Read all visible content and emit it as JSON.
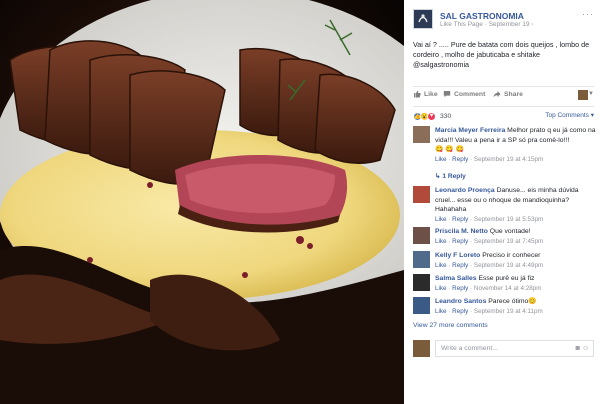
{
  "post": {
    "page_name": "SAL GASTRONOMIA",
    "like_page": "Like This Page",
    "date": "September 19",
    "text": "Vai aí ? ..... Pure de batata com dois queijos , lombo de cordeiro , molho de jabuticaba e shitake @salgastronomia"
  },
  "actions": {
    "like": "Like",
    "comment": "Comment",
    "share": "Share"
  },
  "reactions": {
    "count": "330",
    "top_comments": "Top Comments"
  },
  "comments": [
    {
      "name": "Marcia Meyer Ferreira",
      "text": "Melhor prato q eu já como na vida!!! Valeu a pena ir a SP só pra comê-lo!!!",
      "extra": "😋 😋 😋",
      "like": "Like",
      "reply": "Reply",
      "time": "September 19 at 4:15pm",
      "avatar": "#8a6e5a"
    },
    {
      "name": "Leonardo Proença",
      "text": "Danuse... eis minha dúvida cruel... esse ou o nhoque de mandioquinha? Hahahaha",
      "like": "Like",
      "reply": "Reply",
      "time": "September 19 at 5:53pm",
      "avatar": "#b24a3c"
    },
    {
      "name": "Priscila M. Netto",
      "text": "Que vontade!",
      "like": "Like",
      "reply": "Reply",
      "time": "September 19 at 7:45pm",
      "avatar": "#6d5149"
    },
    {
      "name": "Kelly F Loreto",
      "text": "Preciso ir conhecer",
      "like": "Like",
      "reply": "Reply",
      "time": "September 19 at 4:49pm",
      "avatar": "#4f6a8a"
    },
    {
      "name": "Salma Salles",
      "text": "Esse purê eu já fiz",
      "like": "Like",
      "reply": "Reply",
      "time": "November 14 at 4:28pm",
      "avatar": "#2b2b2b"
    },
    {
      "name": "Leandro Santos",
      "text": "Parece ótimo😊",
      "like": "Like",
      "reply": "Reply",
      "time": "September 19 at 4:11pm",
      "avatar": "#3c5a86"
    }
  ],
  "reply_link": "1 Reply",
  "view_more": "View 27 more comments",
  "write_placeholder": "Write a comment...",
  "colors": {
    "link": "#365899",
    "meta": "#90949c",
    "like_blue": "#4e7fd3",
    "love_red": "#ed3b58",
    "wow_yellow": "#f7c94e"
  },
  "icons": [
    "like-icon",
    "comment-icon",
    "share-icon",
    "camera-icon",
    "sticker-icon"
  ]
}
